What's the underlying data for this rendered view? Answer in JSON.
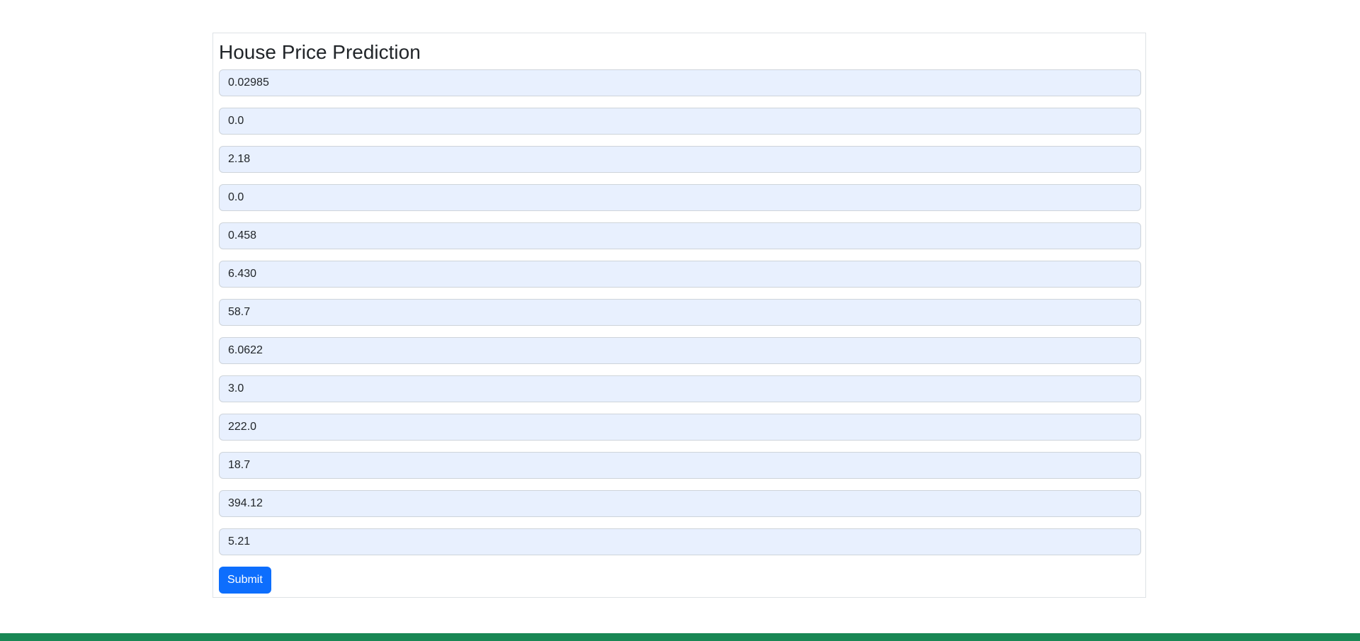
{
  "form": {
    "title": "House Price Prediction",
    "fields": [
      "0.02985",
      "0.0",
      "2.18",
      "0.0",
      "0.458",
      "6.430",
      "58.7",
      "6.0622",
      "3.0",
      "222.0",
      "18.7",
      "394.12",
      "5.21"
    ],
    "submit_label": "Submit"
  },
  "colors": {
    "input_background": "#e8f0fe",
    "button_primary": "#0d6efd",
    "footer_bar": "#198754"
  }
}
